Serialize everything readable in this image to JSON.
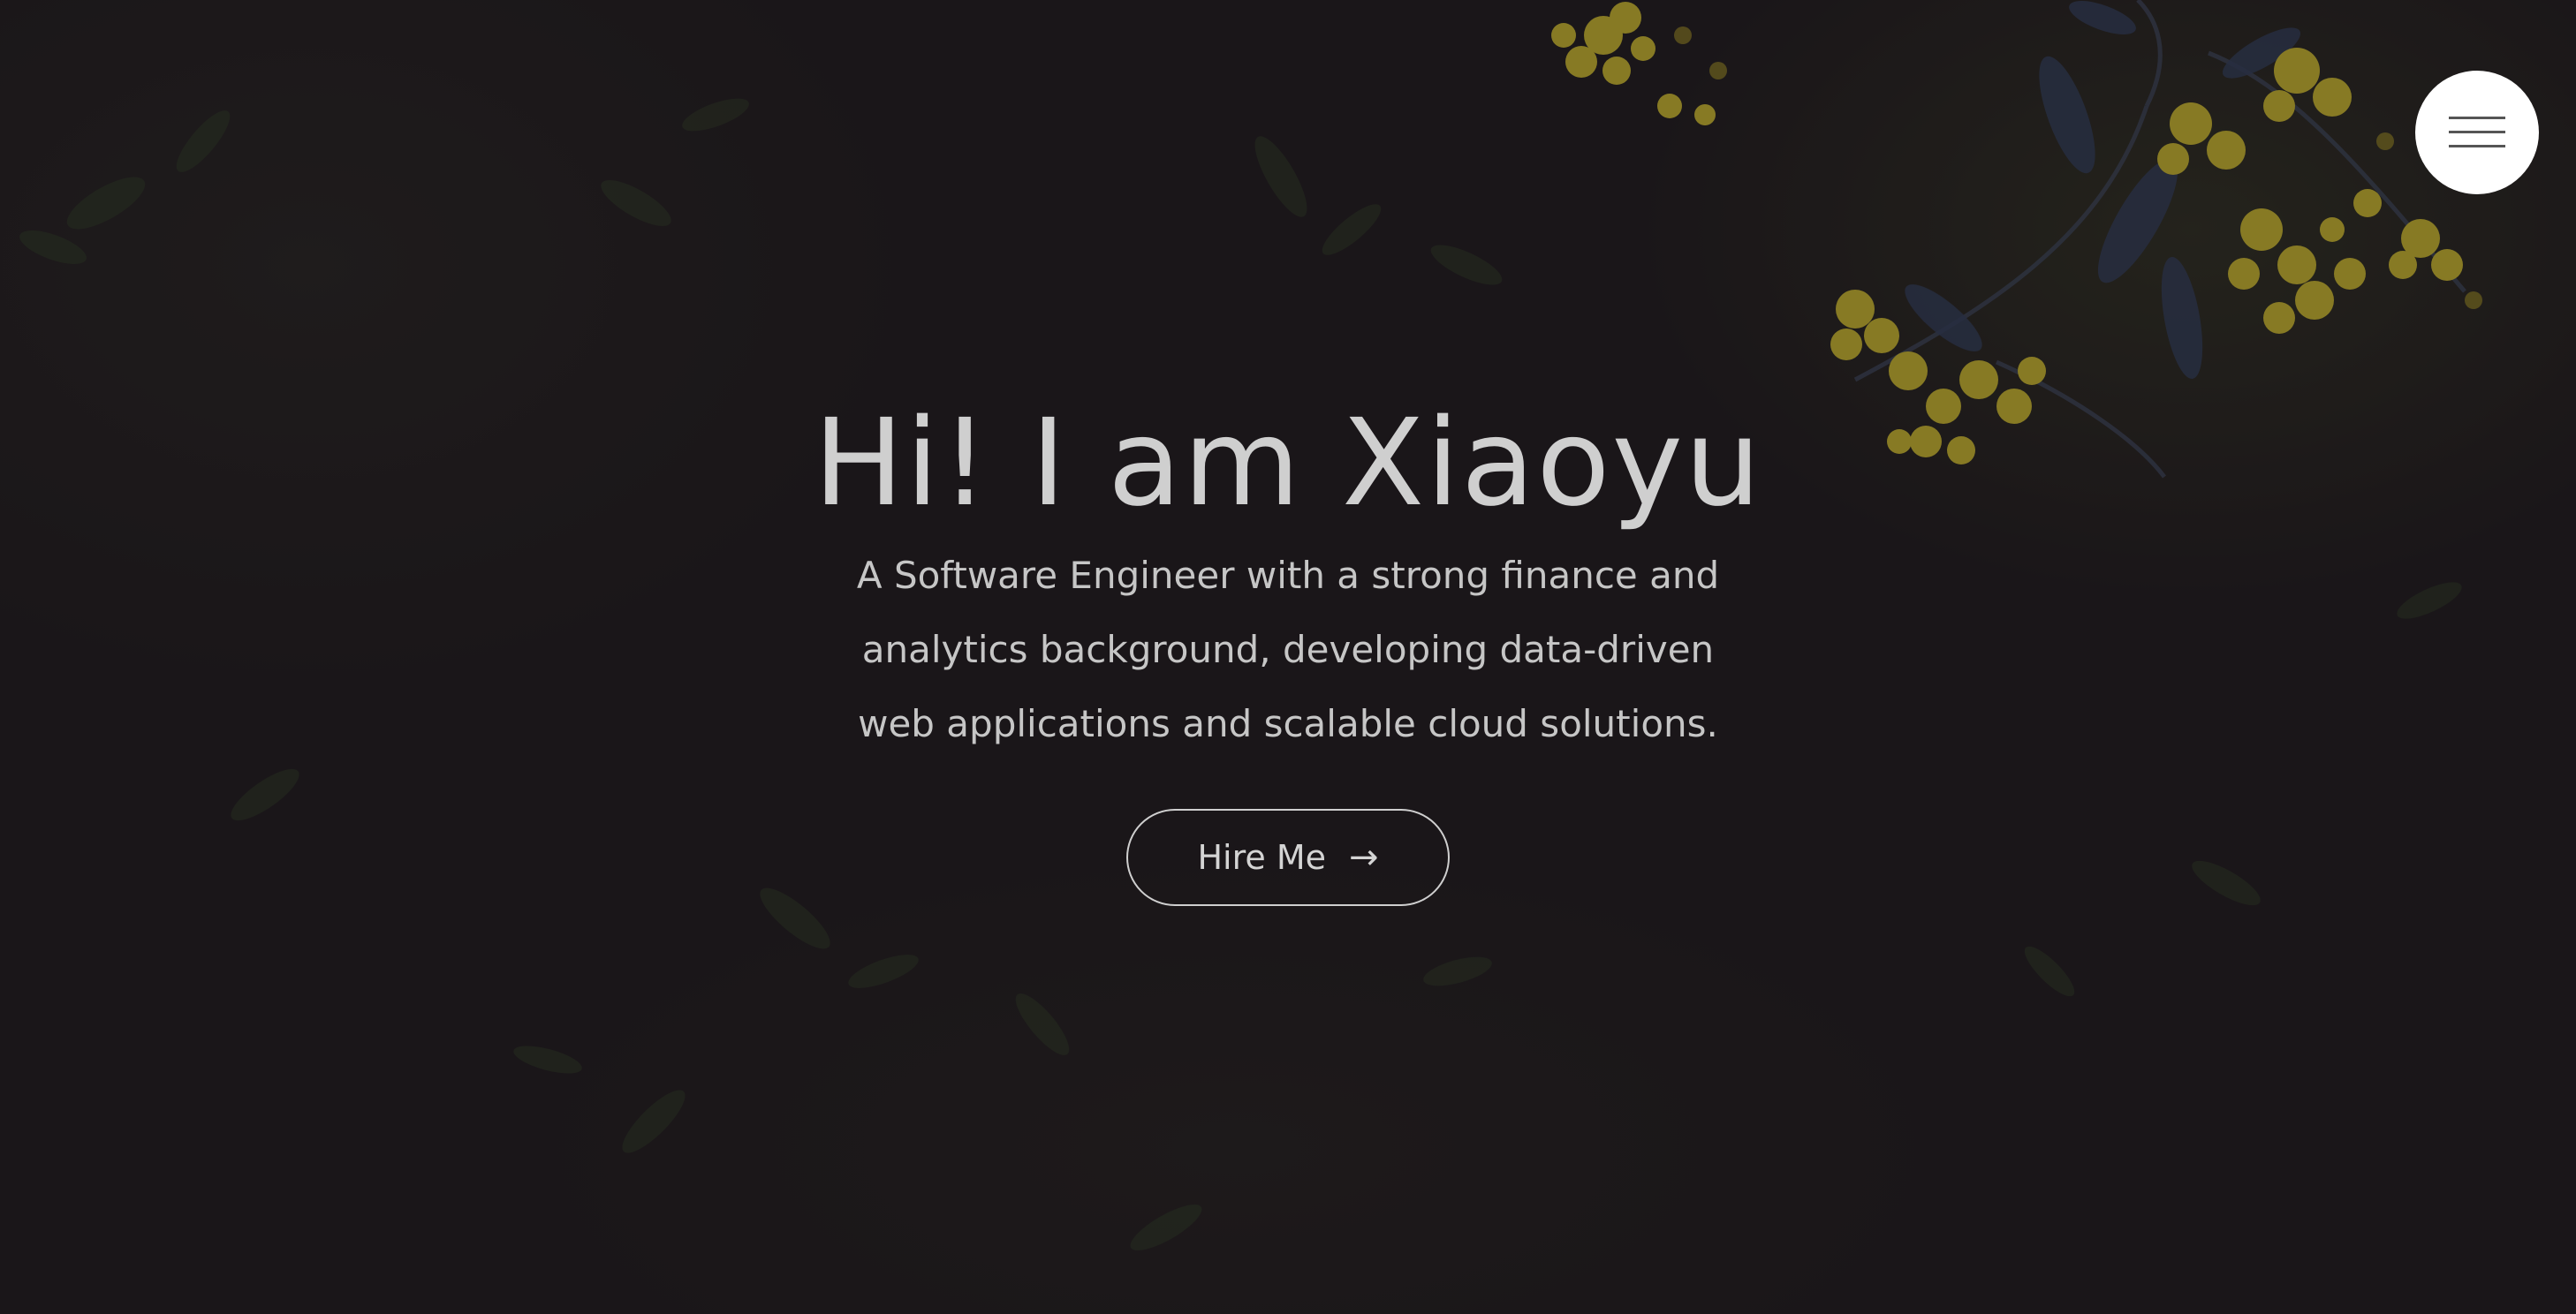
{
  "hero": {
    "title": "Hi! I am Xiaoyu",
    "subtitle": "A Software Engineer with a strong finance and analytics background, developing data-driven web applications and scalable cloud solutions.",
    "cta_label": "Hire Me",
    "cta_icon": "arrow-right-icon",
    "cta_arrow": "→"
  },
  "nav": {
    "menu_icon": "hamburger-icon"
  },
  "colors": {
    "background": "#1b1619",
    "text": "#c9c9c9",
    "menu_button_bg": "#ffffff",
    "accent_flowers": "#c9b52a"
  }
}
